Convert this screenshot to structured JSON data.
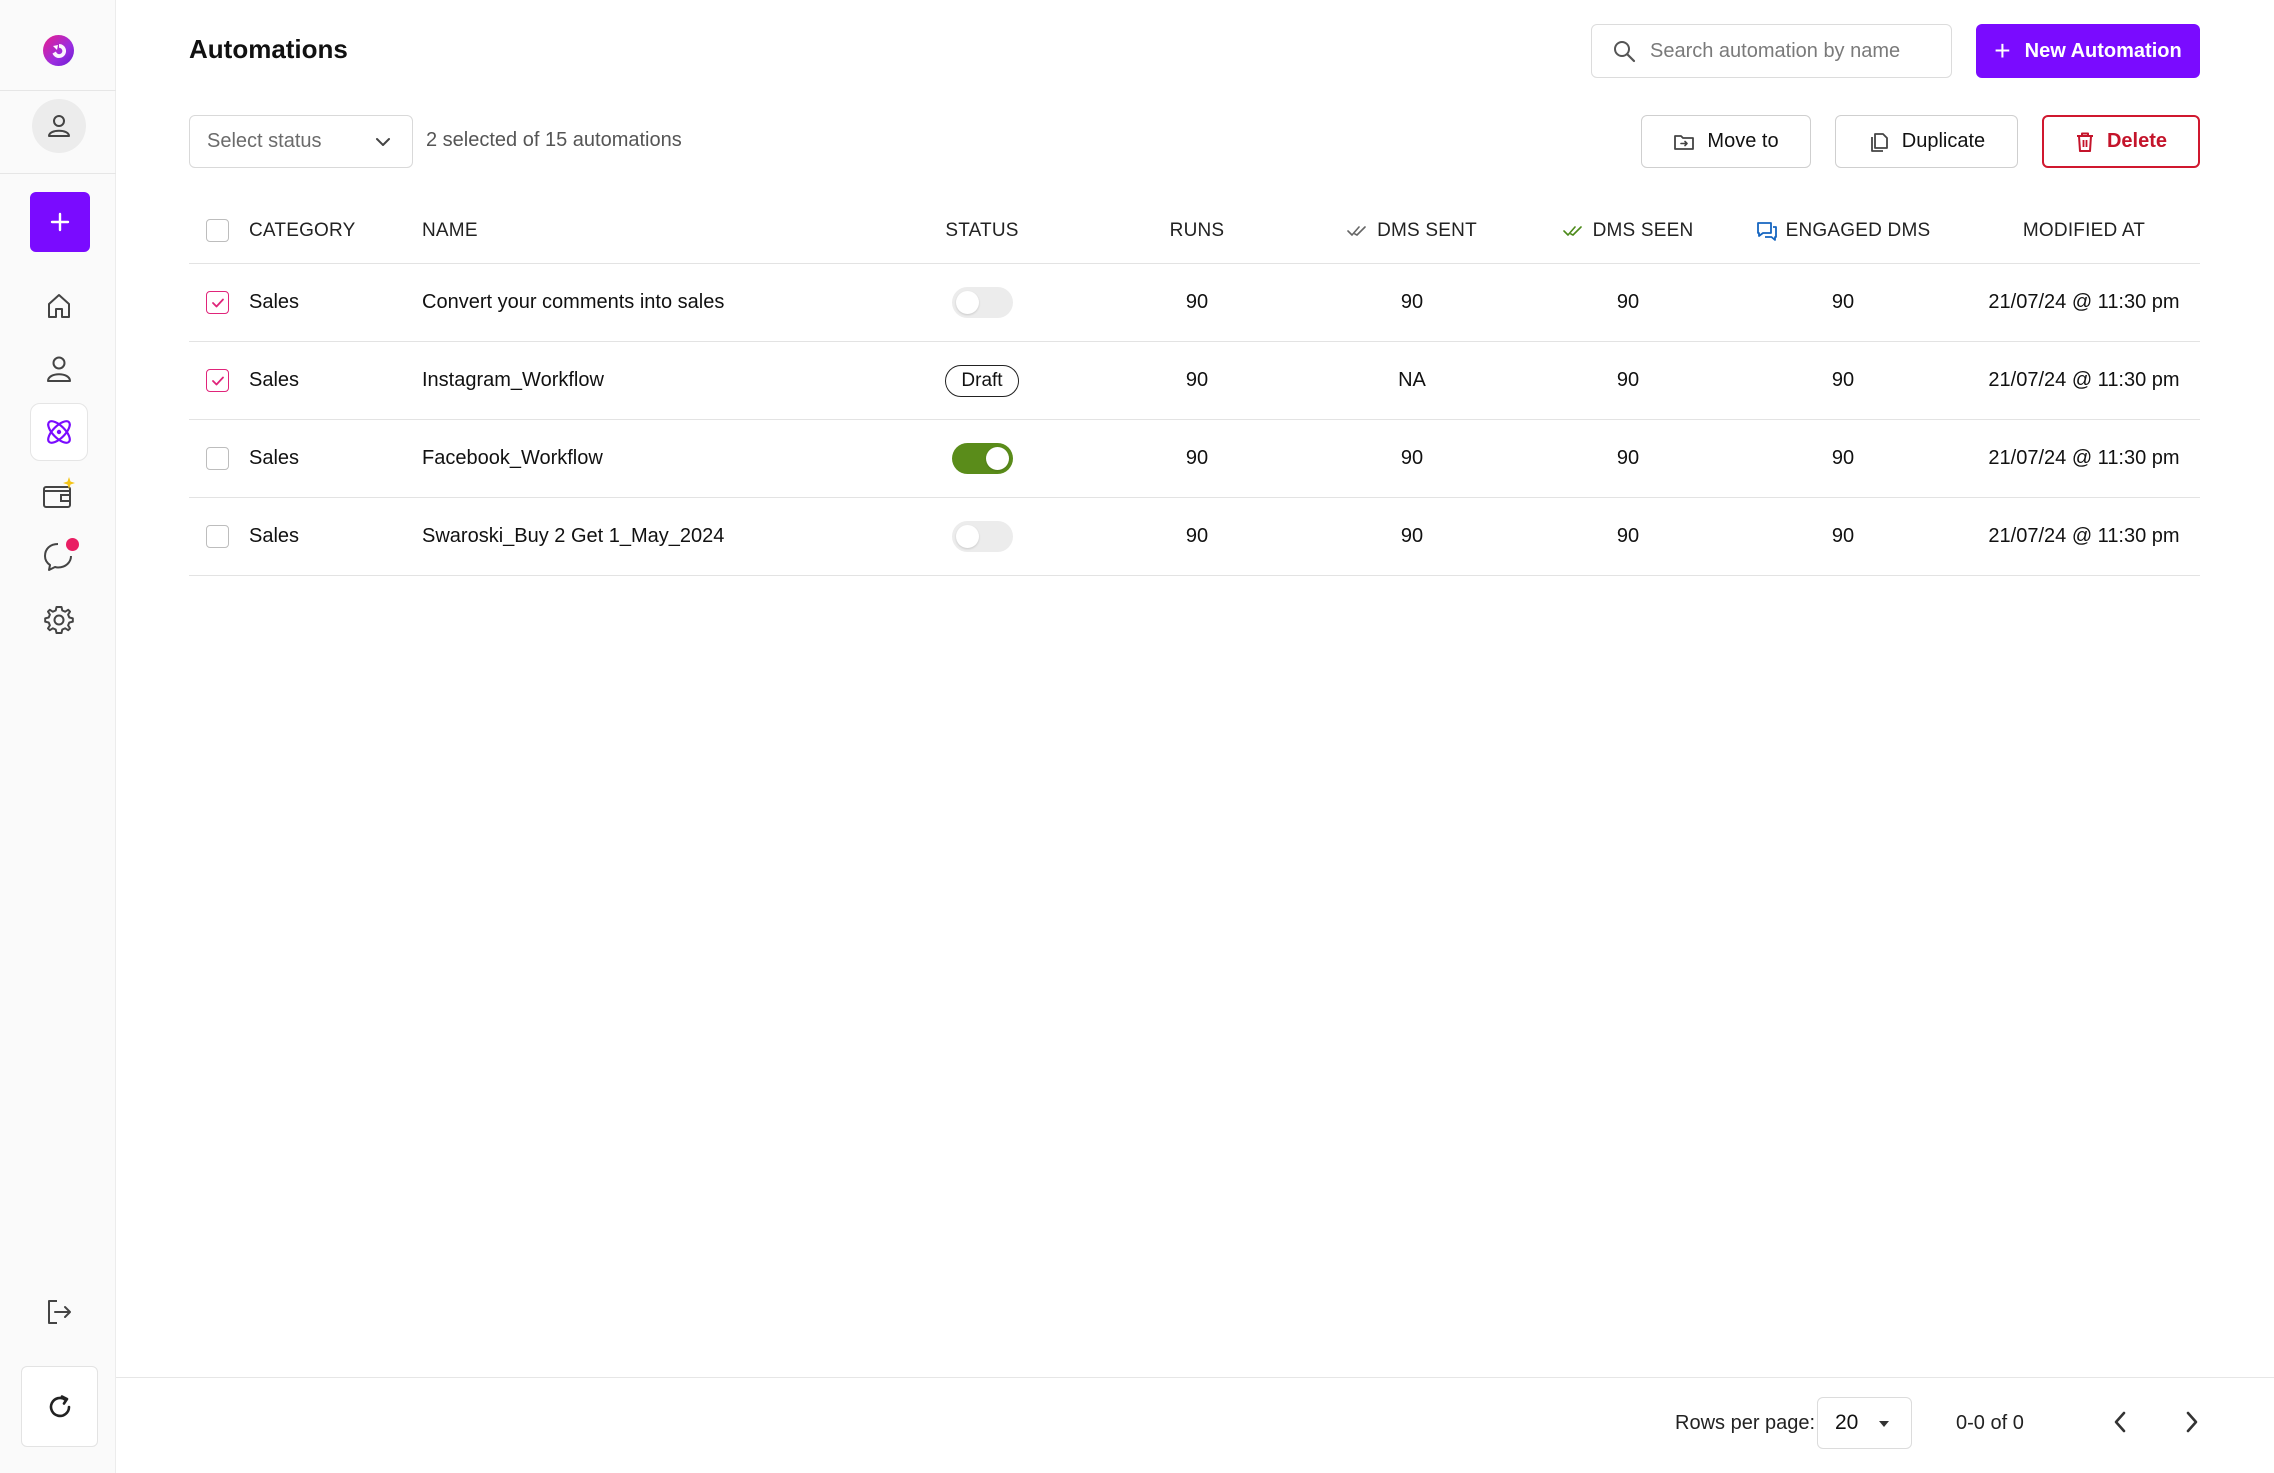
{
  "page": {
    "title": "Automations"
  },
  "search": {
    "placeholder": "Search automation by name",
    "value": ""
  },
  "actions": {
    "new_automation": "New Automation",
    "move_to": "Move to",
    "duplicate": "Duplicate",
    "delete": "Delete"
  },
  "filter": {
    "status_placeholder": "Select status",
    "selection_summary": "2 selected of 15 automations"
  },
  "table": {
    "columns": {
      "category": "CATEGORY",
      "name": "NAME",
      "status": "STATUS",
      "runs": "RUNS",
      "dms_sent": "DMS SENT",
      "dms_seen": "DMS SEEN",
      "engaged_dms": "ENGAGED DMS",
      "modified_at": "MODIFIED AT"
    },
    "rows": [
      {
        "checked": true,
        "category": "Sales",
        "name": "Convert your comments into sales",
        "status": "toggle-off",
        "runs": "90",
        "dms_sent": "90",
        "dms_seen": "90",
        "engaged_dms": "90",
        "modified_at": "21/07/24 @ 11:30 pm"
      },
      {
        "checked": true,
        "category": "Sales",
        "name": "Instagram_Workflow",
        "status": "Draft",
        "runs": "90",
        "dms_sent": "NA",
        "dms_seen": "90",
        "engaged_dms": "90",
        "modified_at": "21/07/24 @ 11:30 pm"
      },
      {
        "checked": false,
        "category": "Sales",
        "name": "Facebook_Workflow",
        "status": "toggle-on",
        "runs": "90",
        "dms_sent": "90",
        "dms_seen": "90",
        "engaged_dms": "90",
        "modified_at": "21/07/24 @ 11:30 pm"
      },
      {
        "checked": false,
        "category": "Sales",
        "name": "Swaroski_Buy 2 Get 1_May_2024",
        "status": "toggle-off",
        "runs": "90",
        "dms_sent": "90",
        "dms_seen": "90",
        "engaged_dms": "90",
        "modified_at": "21/07/24 @ 11:30 pm"
      }
    ]
  },
  "pagination": {
    "rows_per_page_label": "Rows per page:",
    "rows_per_page_value": "20",
    "range": "0-0 of 0"
  },
  "sidebar": {
    "items": [
      {
        "icon": "home-icon"
      },
      {
        "icon": "contacts-icon"
      },
      {
        "icon": "automation-atom-icon",
        "active": true
      },
      {
        "icon": "wallet-sparkle-icon"
      },
      {
        "icon": "chat-icon",
        "badge": true
      },
      {
        "icon": "settings-gear-icon"
      }
    ]
  },
  "colors": {
    "brand_purple": "#7a0bff",
    "delete_red": "#d0182f",
    "toggle_on_green": "#5a8c1a",
    "check_pink": "#e0247a"
  }
}
